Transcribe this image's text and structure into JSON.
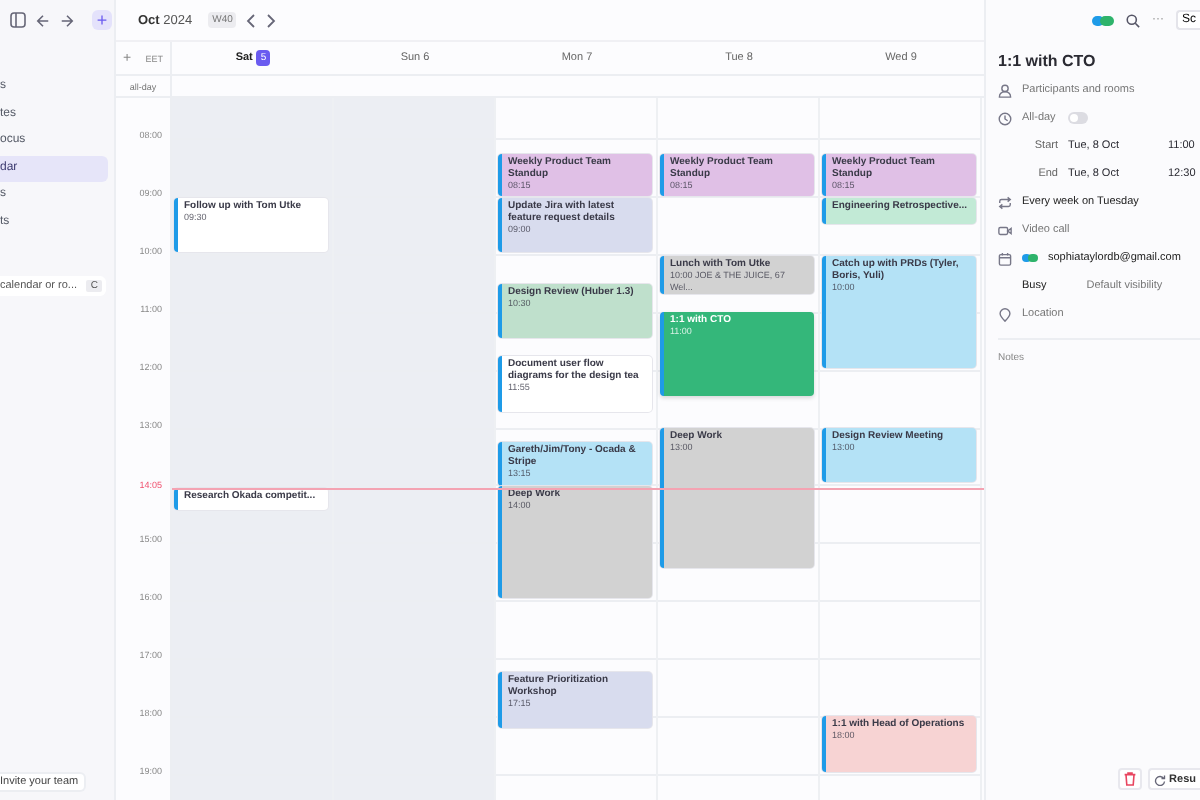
{
  "toolbar": {
    "new_label": "+"
  },
  "sidebar": {
    "items": [
      {
        "label": "s",
        "selected": false
      },
      {
        "label": "tes",
        "selected": false
      },
      {
        "label": "ocus",
        "selected": false
      },
      {
        "label": "dar",
        "selected": true
      },
      {
        "label": "s",
        "selected": false
      },
      {
        "label": "ts",
        "selected": false
      }
    ],
    "search": {
      "placeholder": "calendar or ro...",
      "shortcut": "C"
    },
    "invite": "Invite your team"
  },
  "header": {
    "month": "Oct",
    "year": "2024",
    "week": "W40",
    "more": "···",
    "schedule_button": "Sc"
  },
  "grid": {
    "add": "+",
    "timezone": "EET",
    "all_day": "all-day",
    "hours": [
      "08:00",
      "09:00",
      "10:00",
      "11:00",
      "12:00",
      "13:00",
      "15:00",
      "16:00",
      "17:00",
      "18:00",
      "19:00"
    ],
    "now": "14:05",
    "days": [
      {
        "label": "Sat",
        "date": "5",
        "today": true,
        "weekend": true,
        "events": [
          {
            "title": "Follow up with Tom Utke",
            "time": "09:30",
            "color": "#ffffff",
            "selected": false
          },
          {
            "title": "Research Okada competit...",
            "color": "#ffffff",
            "selected": false
          }
        ]
      },
      {
        "label": "Sun",
        "date": "6",
        "today": false,
        "weekend": true
      },
      {
        "label": "Mon",
        "date": "7",
        "today": false,
        "weekend": false,
        "events": [
          {
            "title": "Weekly Product Team Standup",
            "time": "08:15",
            "color": "#e0c0e6",
            "selected": false
          },
          {
            "title": "Update Jira with latest feature request details",
            "time": "09:00",
            "color": "#d8dcee",
            "selected": false
          },
          {
            "title": "Design Review (Huber 1.3)",
            "time": "10:30",
            "color": "#bfe0cc",
            "selected": false
          },
          {
            "title": "Document user flow diagrams for the design tea",
            "time": "11:55",
            "color": "#ffffff",
            "selected": false
          },
          {
            "title": "Gareth/Jim/Tony - Ocada & Stripe",
            "time": "13:15",
            "color": "#b4e2f6",
            "selected": false
          },
          {
            "title": "Deep Work",
            "time": "14:00",
            "color": "#d2d2d2",
            "selected": false
          },
          {
            "title": "Feature Prioritization Workshop",
            "time": "17:15",
            "color": "#d8dcee",
            "selected": false
          }
        ]
      },
      {
        "label": "Tue",
        "date": "8",
        "today": false,
        "weekend": false,
        "events": [
          {
            "title": "Weekly Product Team Standup",
            "time": "08:15",
            "color": "#e0c0e6",
            "selected": false
          },
          {
            "title": "Lunch with Tom Utke",
            "time": "10:00 JOE & THE JUICE, 67 Wel...",
            "color": "#d2d2d2",
            "selected": false
          },
          {
            "title": "1:1 with CTO",
            "time": "11:00",
            "color": "#34b77a",
            "selected": true
          },
          {
            "title": "Deep Work",
            "time": "13:00",
            "color": "#d2d2d2",
            "selected": false
          }
        ]
      },
      {
        "label": "Wed",
        "date": "9",
        "today": false,
        "weekend": false,
        "events": [
          {
            "title": "Weekly Product Team Standup",
            "time": "08:15",
            "color": "#e0c0e6",
            "selected": false
          },
          {
            "title": "Engineering Retrospective...",
            "color": "#c2ead6",
            "selected": false
          },
          {
            "title": "Catch up with PRDs (Tyler, Boris, Yuli)",
            "time": "10:00",
            "color": "#b4e2f6",
            "selected": false
          },
          {
            "title": "Design Review Meeting",
            "time": "13:00",
            "color": "#b4e2f6",
            "selected": false
          },
          {
            "title": "1:1 with Head of Operations",
            "time": "18:00",
            "color": "#f7d3d3",
            "selected": false
          }
        ]
      }
    ]
  },
  "panel": {
    "title": "1:1 with CTO",
    "participants": "Participants and rooms",
    "all_day": {
      "label": "All-day",
      "on": false
    },
    "start": {
      "label": "Start",
      "date": "Tue, 8 Oct",
      "time": "11:00"
    },
    "end": {
      "label": "End",
      "date": "Tue, 8 Oct",
      "time": "12:30"
    },
    "repeat": "Every week on Tuesday",
    "video": "Video call",
    "account": "sophiataylordb@gmail.com",
    "availability": "Busy",
    "visibility": "Default visibility",
    "location": "Location",
    "notes": "Notes",
    "resume_button": "Resu"
  }
}
